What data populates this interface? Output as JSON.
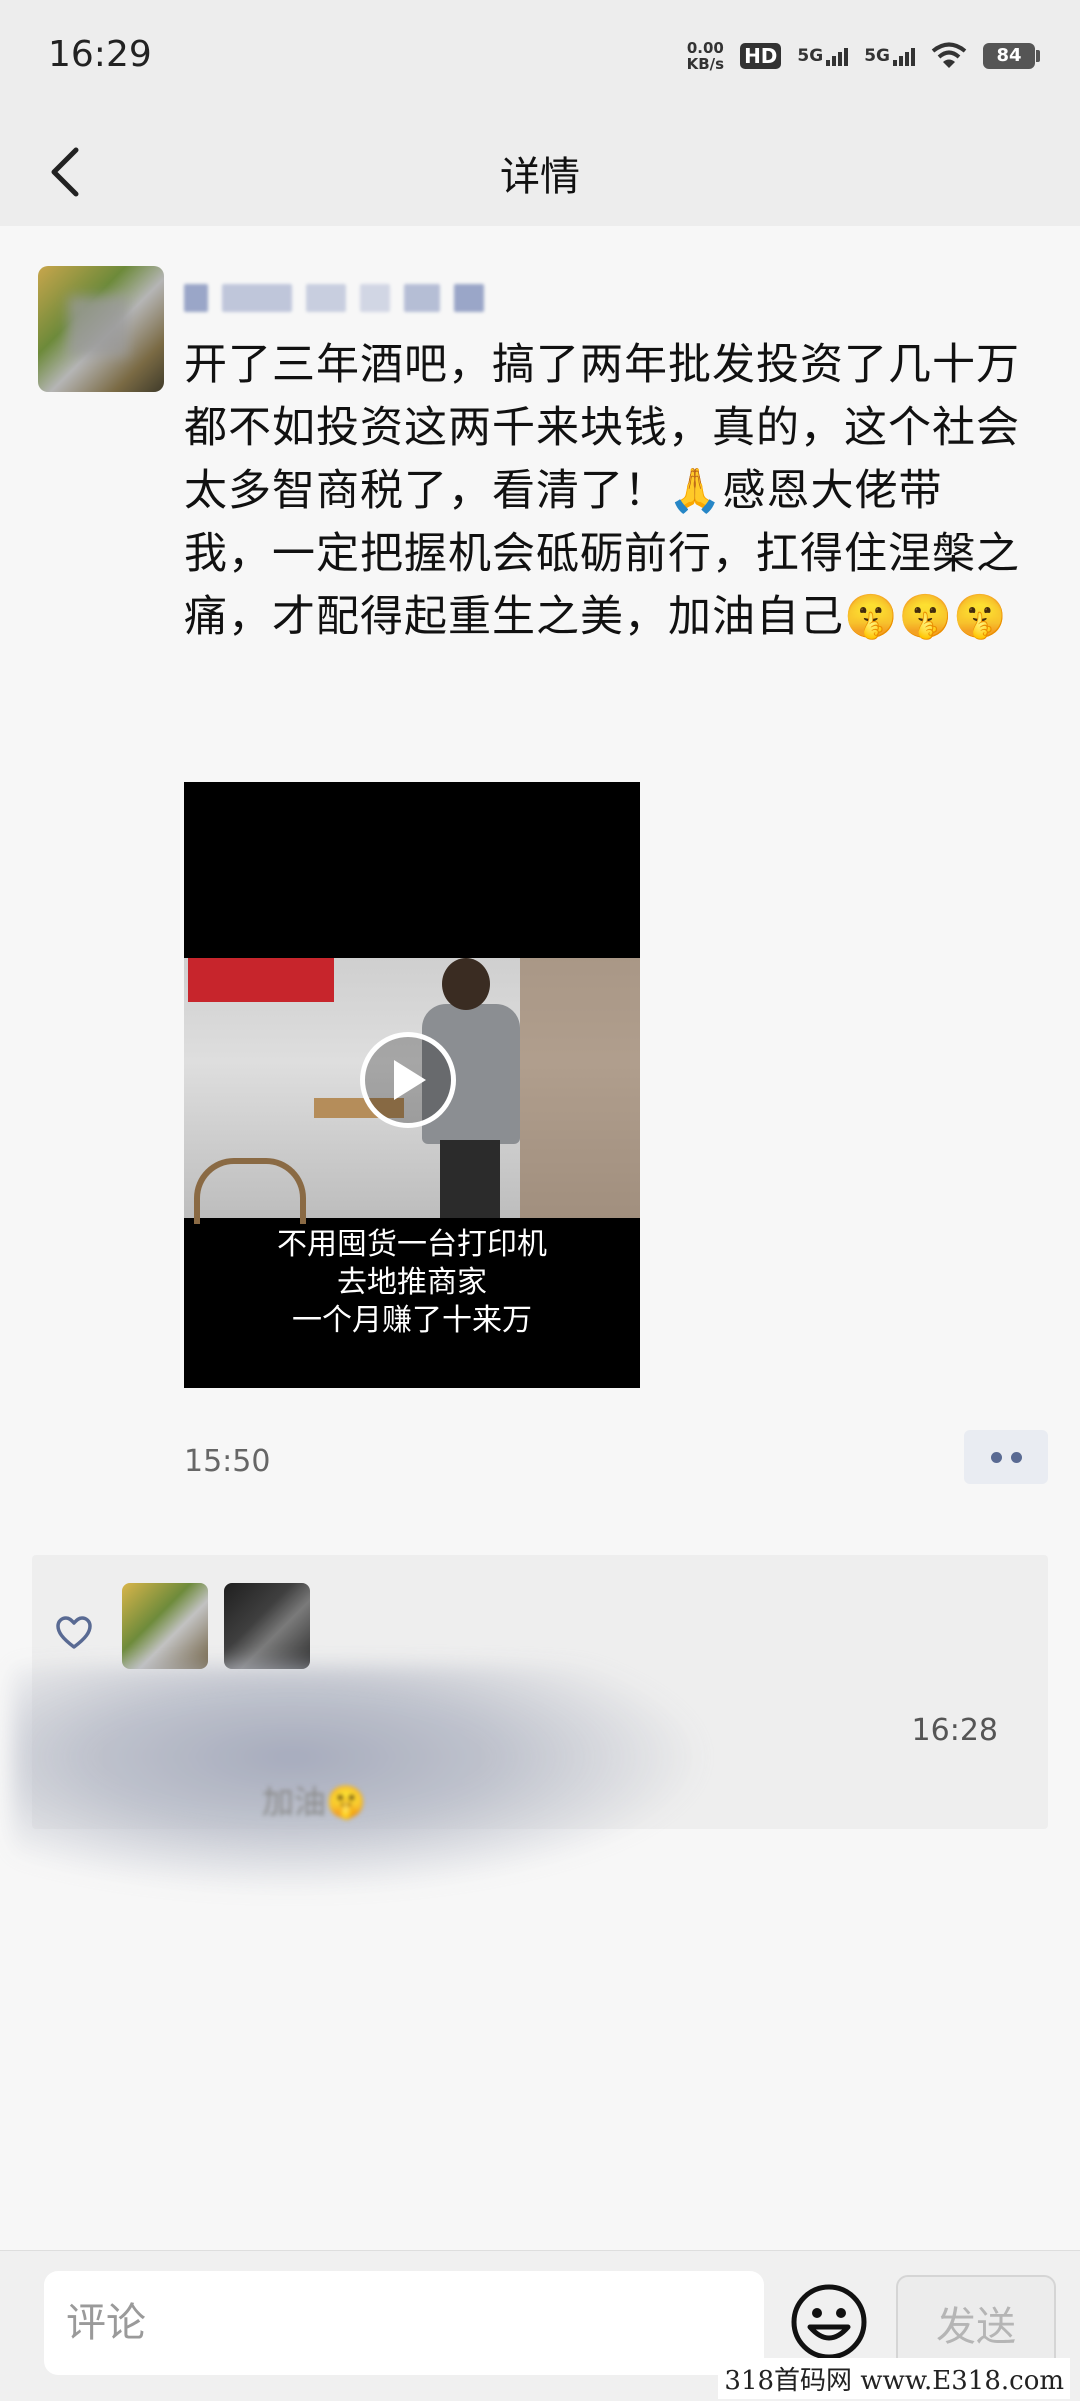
{
  "status_bar": {
    "time": "16:29",
    "net_speed_value": "0.00",
    "net_speed_unit": "KB/s",
    "hd_label": "HD",
    "sim1_label": "5G",
    "sim2_label": "5G",
    "battery": "84",
    "icons": [
      "hd-icon",
      "signal-icon",
      "signal-icon",
      "wifi-icon",
      "battery-icon"
    ]
  },
  "nav": {
    "title": "详情",
    "back_icon": "chevron-left-icon"
  },
  "post": {
    "text": "开了三年酒吧，搞了两年批发投资了几十万都不如投资这两千来块钱，真的，这个社会太多智商税了，看清了！🙏感恩大佬带我，一定把握机会砥砺前行，扛得住涅槃之痛，才配得起重生之美，加油自己🤫🤫🤫",
    "video_caption_line1": "不用囤货一台打印机",
    "video_caption_line2": "去地推商家",
    "video_caption_line3": "一个月赚了十来万",
    "time": "15:50",
    "more_icon": "more-dots-icon"
  },
  "interactions": {
    "like_icon": "heart-outline-icon",
    "comment_time": "16:28",
    "comment_text": "加油🤫"
  },
  "bottom_bar": {
    "comment_placeholder": "评论",
    "emoji_icon": "smiley-icon",
    "send_label": "发送"
  },
  "watermark": "318首码网 www.E318.com",
  "colors": {
    "bar_bg": "#ededed",
    "page_bg": "#f7f7f7",
    "link_blue": "#596a93"
  }
}
